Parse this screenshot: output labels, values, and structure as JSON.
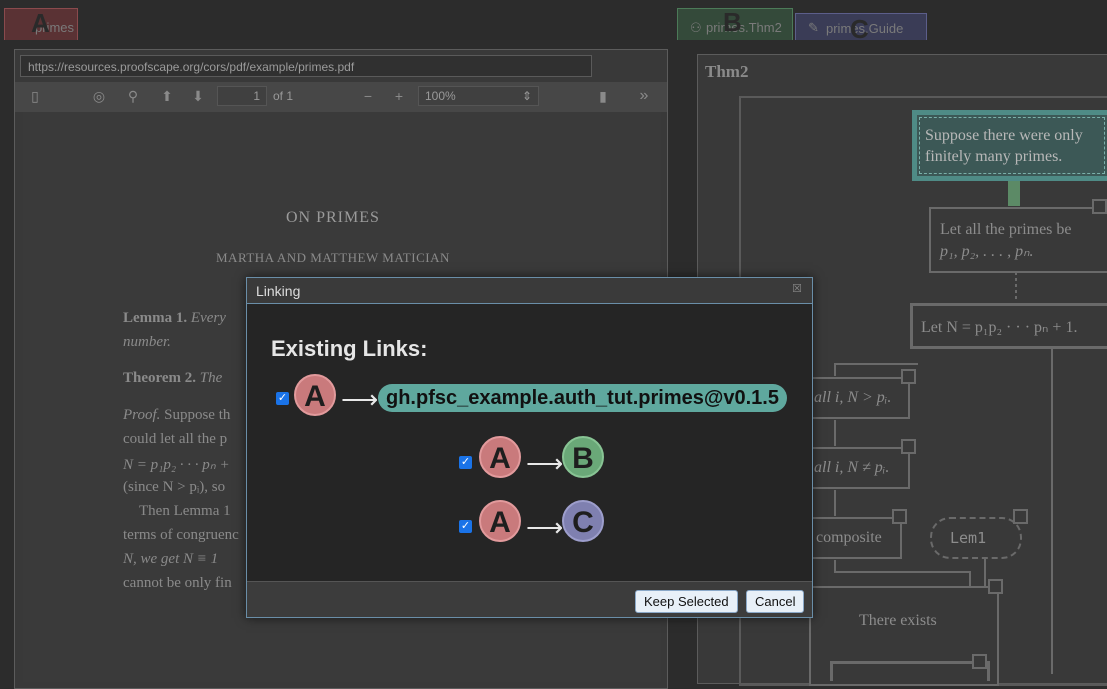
{
  "tabs": {
    "a": {
      "letter": "A",
      "label": "primes"
    },
    "b": {
      "letter": "B",
      "label": "primes.Thm2"
    },
    "c": {
      "letter": "C",
      "label": "primes.Guide"
    }
  },
  "pdf": {
    "url": "https://resources.proofscape.org/cors/pdf/example/primes.pdf",
    "page_number": "1",
    "page_count": "of 1",
    "zoom": "100%",
    "title": "ON PRIMES",
    "authors": "MARTHA AND MATTHEW MATICIAN",
    "lemma_head": "Lemma 1.",
    "lemma_text": "Every",
    "lemma_text2": "number.",
    "theorem_head": "Theorem 2.",
    "theorem_text": "The",
    "proof_head": "Proof.",
    "proof_lines": [
      "Suppose th",
      "could let all the p",
      "N = p₁p₂ · · · pₙ +",
      "(since N > pᵢ), so",
      "Then Lemma 1",
      "terms of congruenc",
      "N, we get N ≡ 1",
      "cannot be only fin"
    ]
  },
  "graph": {
    "title": "Thm2",
    "node1": [
      "Suppose there were only",
      "finitely many primes."
    ],
    "node2": [
      "Let all the primes be",
      "p₁, p₂, . . . , pₙ."
    ],
    "node3": "Let N = p₁p₂ · · · pₙ + 1.",
    "node4": "all i, N > pᵢ.",
    "node5": "all i, N ≠ pᵢ.",
    "node6": "composite",
    "node7": "Lem1",
    "node8": "There exists"
  },
  "modal": {
    "title": "Linking",
    "heading": "Existing Links:",
    "links": [
      {
        "from": "A",
        "arrow": "⟶",
        "to": "gh.pfsc_example.auth_tut.primes@v0.1.5"
      },
      {
        "from": "A",
        "arrow": "⟶",
        "to": "B"
      },
      {
        "from": "A",
        "arrow": "⟶",
        "to": "C"
      }
    ],
    "keep_label": "Keep Selected",
    "cancel_label": "Cancel"
  },
  "colors": {
    "tab_a": "#c97a7c",
    "tab_b": "#6aa878",
    "tab_c": "#7f80b0",
    "link_pill": "#5fa89e",
    "checkbox": "#1a73e8"
  }
}
